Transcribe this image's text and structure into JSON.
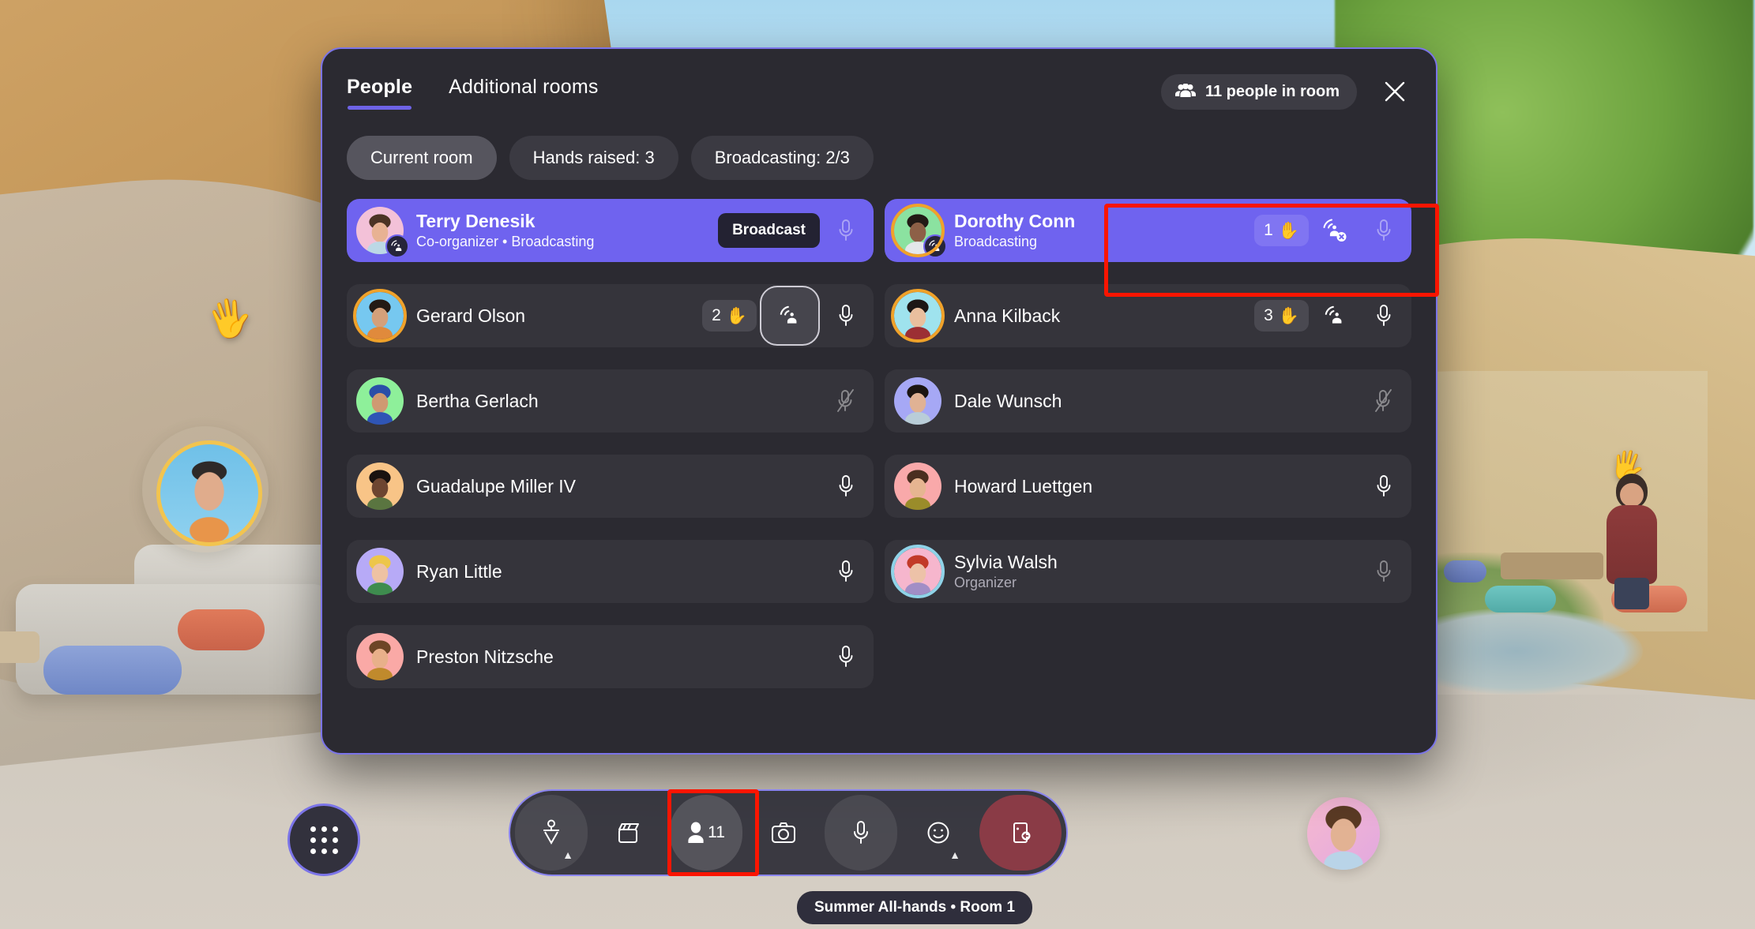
{
  "panel": {
    "tabs": [
      {
        "label": "People",
        "active": true
      },
      {
        "label": "Additional rooms",
        "active": false
      }
    ],
    "people_badge": {
      "label": "11 people in room",
      "icon": "people-group-icon"
    },
    "close_icon": "close-icon",
    "filters": [
      {
        "label": "Current room",
        "selected": true
      },
      {
        "label": "Hands raised: 3",
        "selected": false
      },
      {
        "label": "Broadcasting: 2/3",
        "selected": false
      }
    ]
  },
  "participants": [
    {
      "name": "Terry Denesik",
      "subtitle": "Co-organizer • Broadcasting",
      "highlighted": true,
      "broadcasting": true,
      "hand_count": null,
      "broadcast_tag": "Broadcast",
      "mic": "mic-on-dim",
      "avatar_ring": "none",
      "avatar_bg": "#f3c1d8",
      "skin": "#e8b293",
      "hair": "#4c3324",
      "shirt": "#bcd8e6"
    },
    {
      "name": "Dorothy Conn",
      "subtitle": "Broadcasting",
      "highlighted": true,
      "broadcasting": true,
      "hand_count": "1",
      "broadcast_tag": null,
      "broadcast_action": "broadcast-off-icon",
      "mic": "mic-on-dim",
      "avatar_ring": "orange",
      "avatar_bg": "#8be2a0",
      "skin": "#8d6047",
      "hair": "#221a16",
      "shirt": "#e4e7ea"
    },
    {
      "name": "Gerard Olson",
      "subtitle": null,
      "highlighted": false,
      "broadcasting": false,
      "hand_count": "2",
      "broadcast_action": "broadcast-icon",
      "broadcast_focused": true,
      "mic": "mic-on",
      "avatar_ring": "orange",
      "avatar_bg": "#76c8f0",
      "skin": "#d4a07a",
      "hair": "#231a14",
      "shirt": "#e08a3c"
    },
    {
      "name": "Anna Kilback",
      "subtitle": null,
      "highlighted": false,
      "broadcasting": false,
      "hand_count": "3",
      "broadcast_action": "broadcast-icon",
      "broadcast_focused": false,
      "mic": "mic-on",
      "avatar_ring": "orange",
      "avatar_bg": "#9fe3ee",
      "skin": "#e9bf9e",
      "hair": "#1c1716",
      "shirt": "#9c2f34"
    },
    {
      "name": "Bertha Gerlach",
      "subtitle": null,
      "highlighted": false,
      "broadcasting": false,
      "hand_count": null,
      "broadcast_action": null,
      "mic": "mic-off",
      "avatar_ring": "none",
      "avatar_bg": "#8ef09a",
      "skin": "#cf9a72",
      "hair": "#2a4fa8",
      "shirt": "#2f55b5"
    },
    {
      "name": "Dale Wunsch",
      "subtitle": null,
      "highlighted": false,
      "broadcasting": false,
      "hand_count": null,
      "broadcast_action": null,
      "mic": "mic-off",
      "avatar_ring": "none",
      "avatar_bg": "#a6a8f5",
      "skin": "#e0b294",
      "hair": "#1b1512",
      "shirt": "#b9cdd8"
    },
    {
      "name": "Guadalupe Miller IV",
      "subtitle": null,
      "highlighted": false,
      "broadcasting": false,
      "hand_count": null,
      "broadcast_action": null,
      "mic": "mic-on",
      "avatar_ring": "none",
      "avatar_bg": "#f8c487",
      "skin": "#6d4530",
      "hair": "#191210",
      "shirt": "#5a7540"
    },
    {
      "name": "Howard Luettgen",
      "subtitle": null,
      "highlighted": false,
      "broadcasting": false,
      "hand_count": null,
      "broadcast_action": null,
      "mic": "mic-on",
      "avatar_ring": "none",
      "avatar_bg": "#f9a9aa",
      "skin": "#e6b591",
      "hair": "#4a2e20",
      "shirt": "#9a8c2a"
    },
    {
      "name": "Ryan Little",
      "subtitle": null,
      "highlighted": false,
      "broadcasting": false,
      "hand_count": null,
      "broadcast_action": null,
      "mic": "mic-on",
      "avatar_ring": "none",
      "avatar_bg": "#b7aaf7",
      "skin": "#eec2a3",
      "hair": "#edc64a",
      "shirt": "#3e8c4e"
    },
    {
      "name": "Sylvia Walsh",
      "subtitle": "Organizer",
      "highlighted": false,
      "broadcasting": false,
      "hand_count": null,
      "broadcast_action": null,
      "mic": "mic-on-dim",
      "avatar_ring": "blue",
      "avatar_bg": "#f6b6cd",
      "skin": "#edc2a8",
      "hair": "#c23a28",
      "shirt": "#a18ec6"
    },
    {
      "name": "Preston Nitzsche",
      "subtitle": null,
      "highlighted": false,
      "broadcasting": false,
      "hand_count": null,
      "broadcast_action": null,
      "mic": "mic-on",
      "avatar_ring": "none",
      "avatar_bg": "#faa9a6",
      "skin": "#e8b08a",
      "hair": "#6d4526",
      "shirt": "#c08a2c"
    }
  ],
  "toolbar": {
    "apps_button": "apps-grid-icon",
    "buttons": [
      {
        "name": "avatar-button",
        "icon": "avatar-icon",
        "caret": true,
        "raised": true,
        "label": null
      },
      {
        "name": "immersive-spaces-button",
        "icon": "clapperboard-icon",
        "caret": false,
        "raised": false,
        "label": null
      },
      {
        "name": "people-button",
        "icon": "person-icon",
        "caret": false,
        "raised": true,
        "label": "11"
      },
      {
        "name": "camera-button",
        "icon": "camera-icon",
        "caret": false,
        "raised": false,
        "label": null
      },
      {
        "name": "microphone-button",
        "icon": "microphone-icon",
        "caret": false,
        "raised": true,
        "label": null
      },
      {
        "name": "reactions-button",
        "icon": "emoji-smile-icon",
        "caret": true,
        "raised": false,
        "label": null
      },
      {
        "name": "leave-button",
        "icon": "leave-door-icon",
        "caret": false,
        "raised": false,
        "label": null
      }
    ]
  },
  "room_label": "Summer All-hands • Room 1",
  "colors": {
    "accent_purple": "#6e63e6",
    "highlight_row": "#6f63ef",
    "panel_bg": "#2b2a31",
    "row_bg": "#35343b",
    "annotation_red": "#fb1500",
    "leave_red": "#8a3b46",
    "hand_orange": "#f0a22a"
  }
}
